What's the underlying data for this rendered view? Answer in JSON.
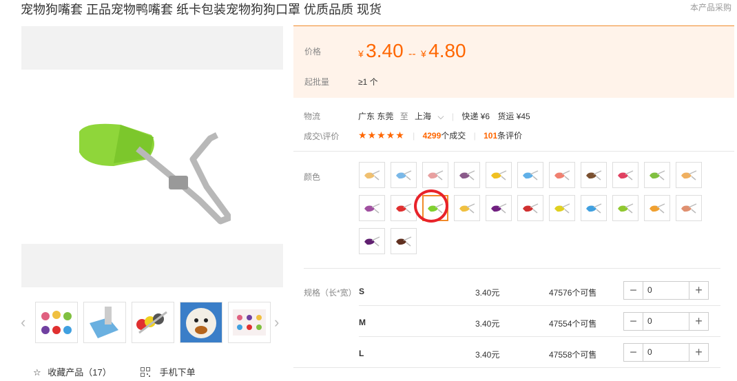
{
  "title": "宠物狗嘴套 正品宠物鸭嘴套 纸卡包装宠物狗狗口罩 优质品质 现货",
  "title_note": "本产品采购",
  "gallery": {
    "favorite_label": "收藏产品（17）",
    "mobile_label": "手机下单"
  },
  "price": {
    "label": "价格",
    "currency": "¥",
    "low": "3.40",
    "separator": "--",
    "high": "4.80",
    "moq_label": "起批量",
    "moq_value": "≥1 个"
  },
  "logistics": {
    "label": "物流",
    "from": "广东 东莞",
    "to_word": "至",
    "to": "上海",
    "express": "快递 ¥6",
    "freight": "货运 ¥45"
  },
  "deals": {
    "label": "成交\\评价",
    "stars": "★★★★★",
    "deal_count": "4299",
    "deal_suffix": "个成交",
    "review_count": "101",
    "review_suffix": "条评价"
  },
  "color": {
    "label": "颜色",
    "selected_index": 13,
    "swatches": [
      "#f0c070",
      "#7ab8e8",
      "#e8a0a0",
      "#8a5a8a",
      "#f0c020",
      "#60b0e8",
      "#f08070",
      "#7a5030",
      "#e04060",
      "#80c040",
      "#f0b060",
      "#a050a0",
      "#e03030",
      "#80d030",
      "#f0c040",
      "#702080",
      "#d03030",
      "#e0d020",
      "#40a0e0",
      "#90c830",
      "#f0a030",
      "#e09070",
      "#602070",
      "#603020"
    ]
  },
  "specs": {
    "label": "规格（长*宽）",
    "rows": [
      {
        "name": "S",
        "price": "3.40元",
        "stock": "47576个可售",
        "qty": "0"
      },
      {
        "name": "M",
        "price": "3.40元",
        "stock": "47554个可售",
        "qty": "0"
      },
      {
        "name": "L",
        "price": "3.40元",
        "stock": "47558个可售",
        "qty": "0"
      }
    ],
    "minus": "−",
    "plus": "+"
  }
}
